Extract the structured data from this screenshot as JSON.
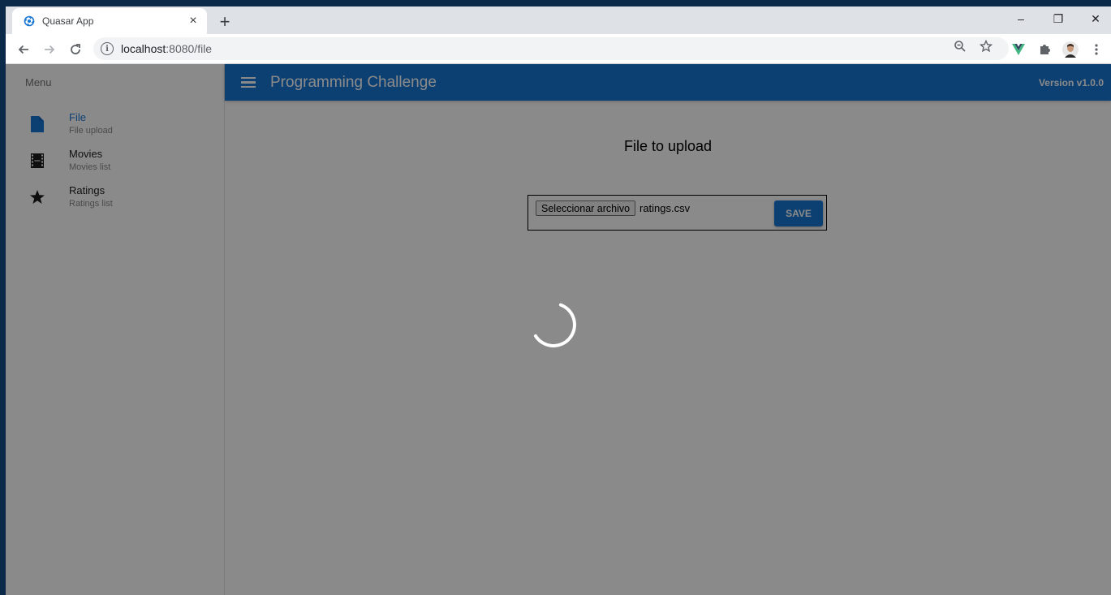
{
  "browser": {
    "tab_title": "Quasar App",
    "tab_close": "×",
    "new_tab": "+",
    "url_host": "localhost",
    "url_path": ":8080/file",
    "info_glyph": "i",
    "window_controls": [
      "–",
      "❐",
      "✕"
    ]
  },
  "sidebar": {
    "header": "Menu",
    "items": [
      {
        "label": "File",
        "caption": "File upload",
        "icon": "file-icon",
        "active": true
      },
      {
        "label": "Movies",
        "caption": "Movies list",
        "icon": "film-icon",
        "active": false
      },
      {
        "label": "Ratings",
        "caption": "Ratings list",
        "icon": "star-icon",
        "active": false
      }
    ]
  },
  "header": {
    "title": "Programming Challenge",
    "version": "Version v1.0.0"
  },
  "main": {
    "heading": "File to upload",
    "file_button": "Seleccionar archivo",
    "file_name": "ratings.csv",
    "save_label": "SAVE"
  },
  "colors": {
    "primary": "#1976d2",
    "overlay": "rgba(0,0,0,0.46)"
  },
  "loading": true
}
